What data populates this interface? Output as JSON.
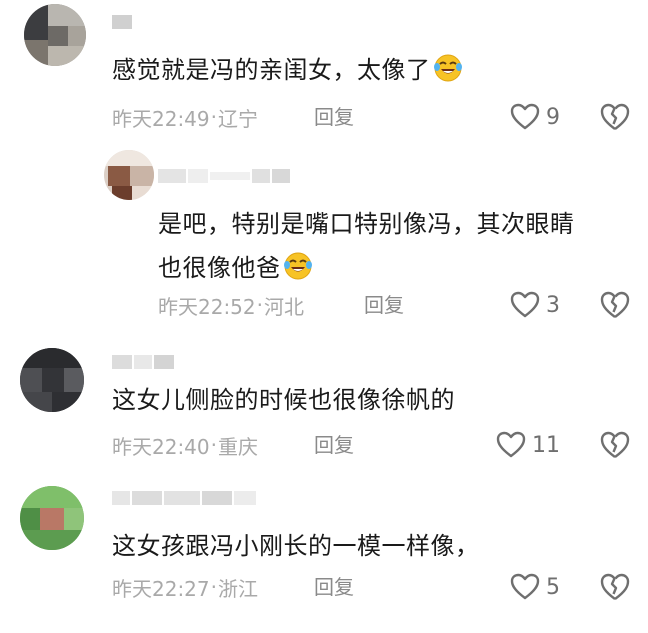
{
  "comments": [
    {
      "text": "感觉就是冯的亲闺女，太像了",
      "emoji": "laughing-tears-emoji",
      "time": "昨天22:49",
      "location": "辽宁",
      "reply_label": "回复",
      "likes": "9"
    },
    {
      "text_line1": "是吧，特别是嘴口特别像冯，其次眼睛",
      "text_line2": "也很像他爸",
      "emoji": "laughing-tears-emoji",
      "time": "昨天22:52",
      "location": "河北",
      "reply_label": "回复",
      "likes": "3"
    },
    {
      "text": "这女儿侧脸的时候也很像徐帆的",
      "time": "昨天22:40",
      "location": "重庆",
      "reply_label": "回复",
      "likes": "11"
    },
    {
      "text": "这女孩跟冯小刚长的一模一样像，",
      "time": "昨天22:27",
      "location": "浙江",
      "reply_label": "回复",
      "likes": "5"
    }
  ],
  "separator": "·",
  "icons": {
    "like": "heart-outline-icon",
    "dislike": "broken-heart-icon",
    "avatar": "blurred-avatar",
    "username": "blurred-username"
  },
  "colors": {
    "text": "#1a1a1a",
    "meta": "#a9a9a9",
    "icon": "#6f6f6f"
  }
}
